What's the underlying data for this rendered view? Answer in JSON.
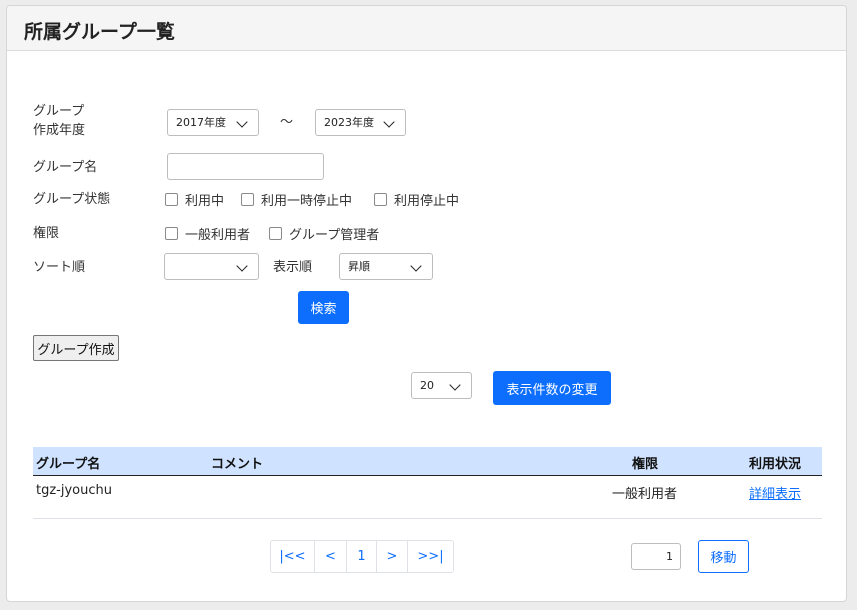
{
  "page": {
    "title": "所属グループ一覧"
  },
  "filters": {
    "year_label_line1": "グループ",
    "year_label_line2": "作成年度",
    "year_from": "2017年度",
    "tilde": "〜",
    "year_to": "2023年度",
    "group_name_label": "グループ名",
    "group_name_value": "",
    "status_label": "グループ状態",
    "status_options": [
      "利用中",
      "利用一時停止中",
      "利用停止中"
    ],
    "role_label": "権限",
    "role_options": [
      "一般利用者",
      "グループ管理者"
    ],
    "sort_label": "ソート順",
    "sort_value": "",
    "order_label": "表示順",
    "order_value": "昇順",
    "search_button": "検索"
  },
  "create_button": "グループ作成",
  "page_size": {
    "value": "20",
    "change_button": "表示件数の変更"
  },
  "table": {
    "headers": [
      "グループ名",
      "コメント",
      "権限",
      "利用状況"
    ],
    "rows": [
      {
        "group_name": "tgz-jyouchu",
        "comment": "",
        "role": "一般利用者",
        "usage": "詳細表示"
      }
    ]
  },
  "pagination": {
    "first": "|<<",
    "prev": "<",
    "current": "1",
    "next": ">",
    "last": ">>|",
    "goto_value": "1",
    "goto_button": "移動"
  }
}
